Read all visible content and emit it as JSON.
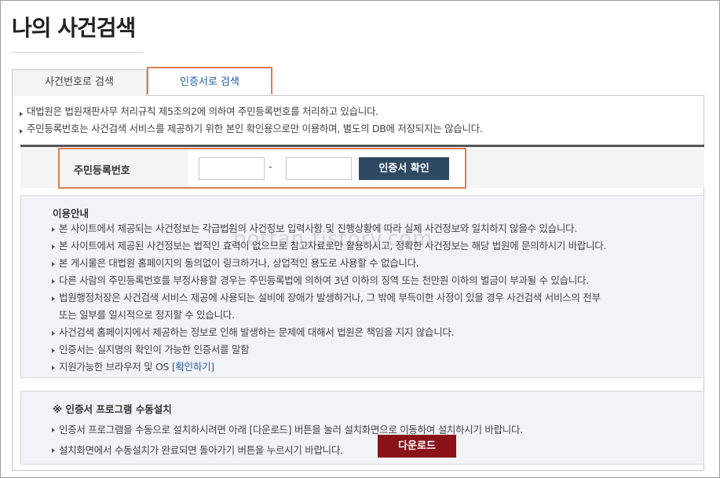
{
  "page": {
    "title": "나의 사건검색"
  },
  "tabs": [
    {
      "label": "사건번호로 검색"
    },
    {
      "label": "인증서로 검색",
      "active": true
    }
  ],
  "notices": [
    "대법원은 법원재판사무 처리규칙 제5조의2에 의하여 주민등록번호를 처리하고 있습니다.",
    "주민등록번호는 사건검색 서비스를 제공하기 위한 본인 확인용으로만 이용하며, 별도의 DB에 저장되지는 않습니다."
  ],
  "id_form": {
    "label": "주민등록번호",
    "first_value": "",
    "second_value": "",
    "separator": "-",
    "confirm_button": "인증서 확인"
  },
  "usage_guide": {
    "title": "이용안내",
    "items": [
      "본 사이트에서 제공되는 사건정보는 각급법원의 사건정보 입력사항 및 진행상황에 따라 실제 사건정보와 일치하지 않을수 있습니다.",
      "본 사이트에서 제공된 사건정보는 법적인 효력이 없으므로 참고자료로만 활용하시고, 정확한 사건정보는 해당 법원에 문의하시기 바랍니다.",
      "본 게시물은 대법원 홈페이지의 동의없이 링크하거나, 상업적인 용도로 사용할 수 없습니다.",
      "다른 사람의 주민등록번호를 부정사용할 경우는 주민등록법에 의하여 3년 이하의 징역 또는 천만원 이하의 벌금이 부과될 수 있습니다.",
      "법원행정처장은 사건검색 서비스 제공에 사용되는 설비에 장애가 발생하거나, 그 밖에 부득이한 사정이 있을 경우 사건검색 서비스의 전부",
      "또는 일부를 일시적으로 정지할 수 있습니다.",
      "사건검색 홈페이지에서 제공하는 정보로 인해 발생하는 문제에 대해서 법원은 책임을 지지 않습니다.",
      "인증서는 실지명의 확인이 가능한 인증서를 말함",
      "지원가능한 브라우저 및 OS"
    ],
    "link_label": "[확인하기]"
  },
  "install": {
    "title": "※ 인증서 프로그램 수동설치",
    "items": [
      "인증서 프로그램을 수동으로 설치하시려면 아래 [다운로드] 버튼을 눌러 설치화면으로 이동하여 설치하시기 바랍니다.",
      "설치화면에서 수동설치가 완료되면 돌아가기 버튼을 누르시기 바랍니다."
    ],
    "download_button": "다운로드"
  },
  "watermark": "bottan.tistory.com",
  "colors": {
    "confirm_button": "#2e4a63",
    "download_button": "#8b1219",
    "highlight_border": "#e07b54",
    "link": "#1f5ca8"
  }
}
